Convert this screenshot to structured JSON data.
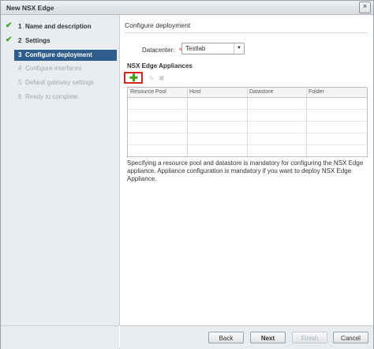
{
  "window": {
    "title": "New NSX Edge",
    "close_glyph": "×"
  },
  "steps": [
    {
      "number": "1",
      "label": "Name and description",
      "state": "done"
    },
    {
      "number": "2",
      "label": "Settings",
      "state": "done"
    },
    {
      "number": "3",
      "label": "Configure deployment",
      "state": "active"
    },
    {
      "number": "4",
      "label": "Configure interfaces",
      "state": "disabled"
    },
    {
      "number": "5",
      "label": "Default gateway settings",
      "state": "disabled"
    },
    {
      "number": "6",
      "label": "Ready to complete",
      "state": "disabled"
    }
  ],
  "check_glyph": "✔",
  "main": {
    "section_title": "Configure deployment",
    "datacenter_label": "Datacenter:",
    "required_mark": "*",
    "datacenter_value": "Testlab",
    "appliances_title": "NSX Edge Appliances",
    "toolbar": {
      "add_glyph": "✚",
      "edit_glyph": "✎",
      "delete_glyph": "✖"
    },
    "columns": [
      "Resource Pool",
      "Host",
      "Datastore",
      "Folder"
    ],
    "info_text": "Specifying a resource pool and datastore is mandatory for configuring the NSX Edge appliance. Appliance configuration is mandatory if you want to deploy NSX Edge Appliance."
  },
  "footer": {
    "back": "Back",
    "next": "Next",
    "finish": "Finish",
    "cancel": "Cancel"
  },
  "colors": {
    "accent": "#2f5d8c",
    "check": "#3aa11a",
    "required": "#d9251c"
  }
}
